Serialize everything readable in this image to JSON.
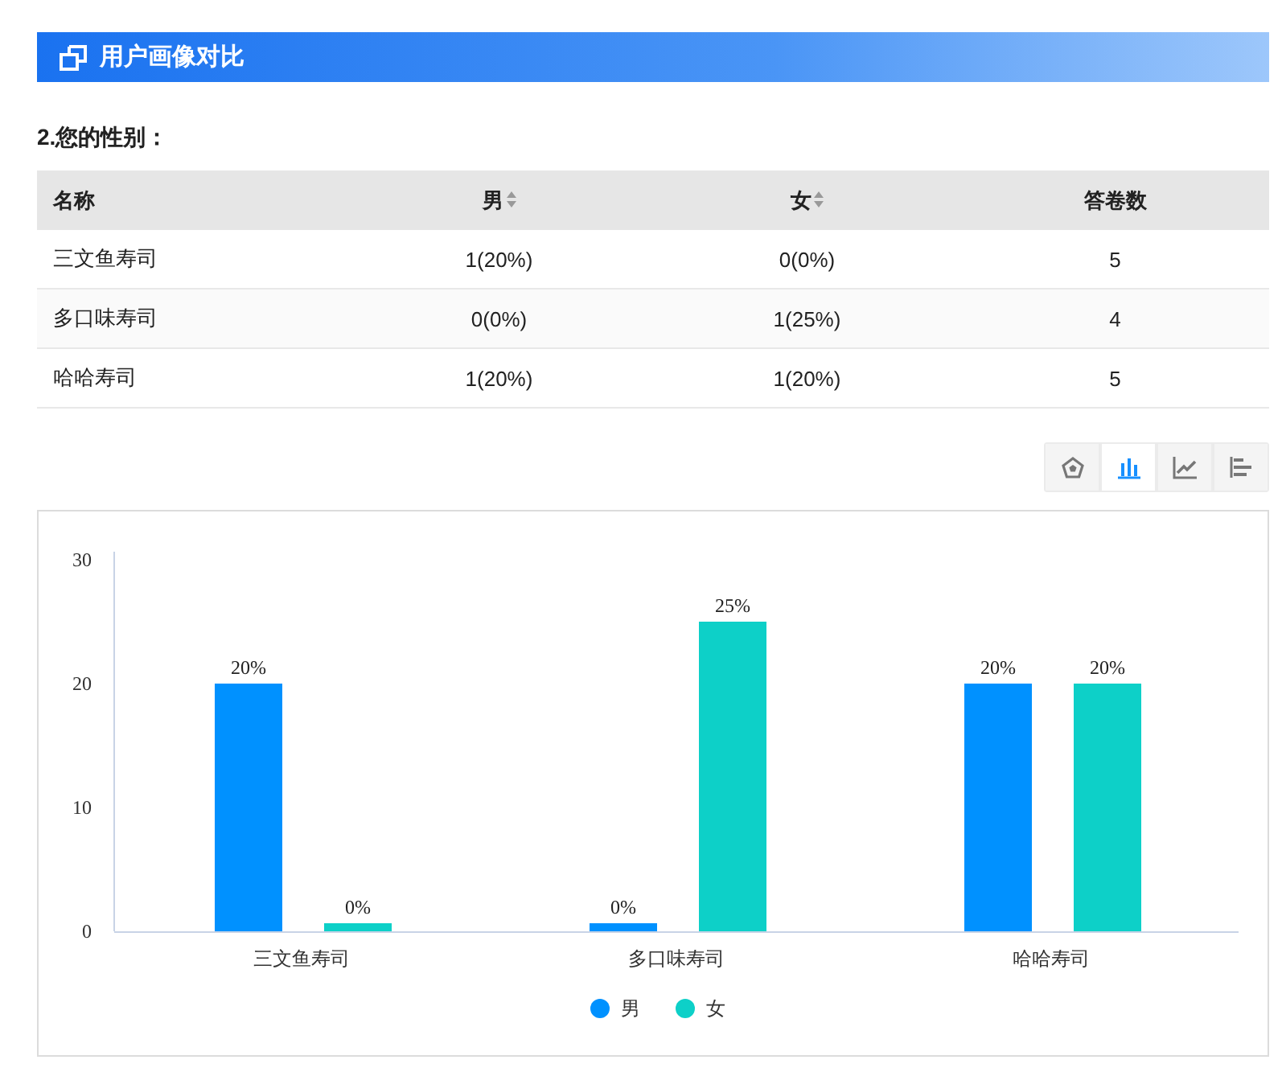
{
  "header": {
    "title": "用户画像对比"
  },
  "question": {
    "title": "2.您的性别："
  },
  "table": {
    "columns": [
      {
        "label": "名称",
        "sortable": false
      },
      {
        "label": "男",
        "sortable": true
      },
      {
        "label": "女",
        "sortable": true
      },
      {
        "label": "答卷数",
        "sortable": false
      }
    ],
    "rows": [
      {
        "cells": [
          "三文鱼寿司",
          "1(20%)",
          "0(0%)",
          "5"
        ]
      },
      {
        "cells": [
          "多口味寿司",
          "0(0%)",
          "1(25%)",
          "4"
        ]
      },
      {
        "cells": [
          "哈哈寿司",
          "1(20%)",
          "1(20%)",
          "5"
        ]
      }
    ]
  },
  "chart_types": [
    {
      "kind": "radar",
      "selected": false
    },
    {
      "kind": "bar",
      "selected": true
    },
    {
      "kind": "line",
      "selected": false
    },
    {
      "kind": "hbar",
      "selected": false
    }
  ],
  "chart": {
    "chart_data": {
      "type": "bar",
      "categories": [
        "三文鱼寿司",
        "多口味寿司",
        "哈哈寿司"
      ],
      "series": [
        {
          "name": "男",
          "color": "#0091ff",
          "values": [
            20,
            0,
            20
          ]
        },
        {
          "name": "女",
          "color": "#0dd0c8",
          "values": [
            0,
            25,
            20
          ]
        }
      ],
      "ylim": [
        0,
        30
      ],
      "yticks": [
        0,
        10,
        20,
        30
      ],
      "legend": "bottom",
      "value_labels": [
        [
          "20%",
          "0%",
          "20%"
        ],
        [
          "0%",
          "25%",
          "20%"
        ]
      ]
    }
  }
}
